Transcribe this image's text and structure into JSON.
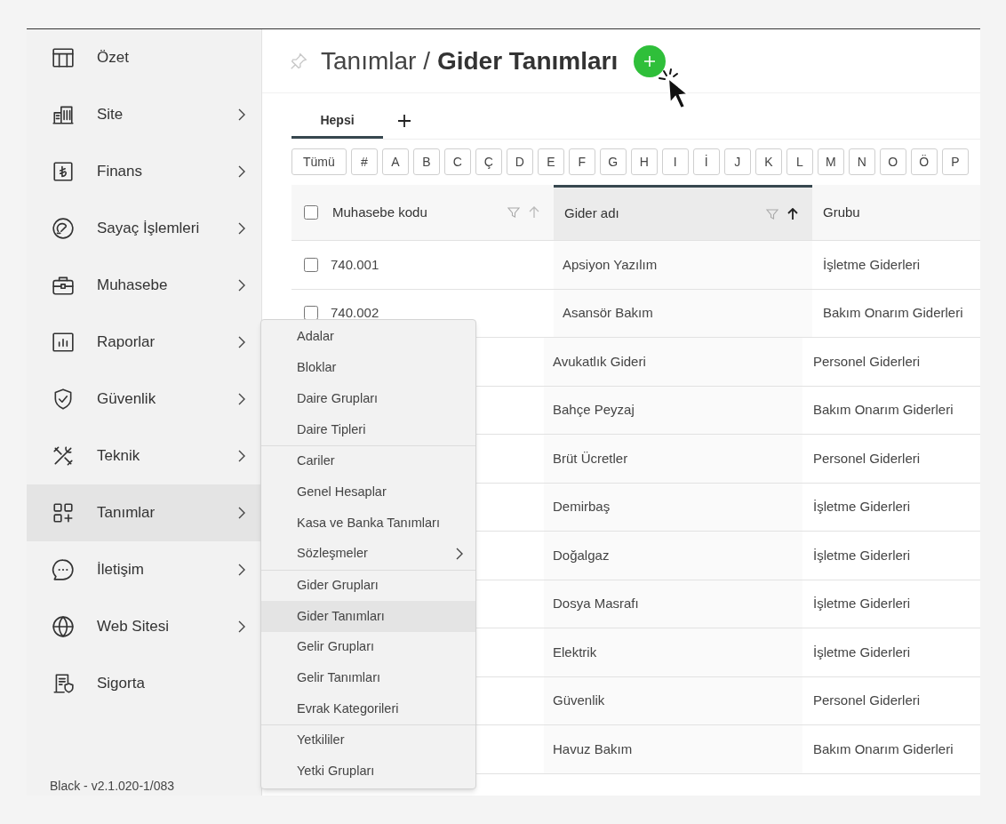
{
  "sidebar": {
    "items": [
      {
        "label": "Özet",
        "has_submenu": false,
        "selected": false
      },
      {
        "label": "Site",
        "has_submenu": true,
        "selected": false
      },
      {
        "label": "Finans",
        "has_submenu": true,
        "selected": false
      },
      {
        "label": "Sayaç İşlemleri",
        "has_submenu": true,
        "selected": false
      },
      {
        "label": "Muhasebe",
        "has_submenu": true,
        "selected": false
      },
      {
        "label": "Raporlar",
        "has_submenu": true,
        "selected": false
      },
      {
        "label": "Güvenlik",
        "has_submenu": true,
        "selected": false
      },
      {
        "label": "Teknik",
        "has_submenu": true,
        "selected": false
      },
      {
        "label": "Tanımlar",
        "has_submenu": true,
        "selected": true
      },
      {
        "label": "İletişim",
        "has_submenu": true,
        "selected": false
      },
      {
        "label": "Web Sitesi",
        "has_submenu": true,
        "selected": false
      },
      {
        "label": "Sigorta",
        "has_submenu": false,
        "selected": false
      }
    ],
    "version": "Black - v2.1.020-1/083"
  },
  "header": {
    "breadcrumb": "Tanımlar /",
    "title": "Gider Tanımları"
  },
  "tabs": [
    {
      "label": "Hepsi",
      "selected": true
    }
  ],
  "letters": [
    "Tümü",
    "#",
    "A",
    "B",
    "C",
    "Ç",
    "D",
    "E",
    "F",
    "G",
    "H",
    "I",
    "İ",
    "J",
    "K",
    "L",
    "M",
    "N",
    "O",
    "Ö",
    "P"
  ],
  "table": {
    "select_all": {
      "checked": false
    },
    "columns": [
      {
        "label": "Muhasebe kodu",
        "sorted": false
      },
      {
        "label": "Gider adı",
        "sorted": true
      },
      {
        "label": "Grubu"
      }
    ],
    "rows": [
      {
        "checked": false,
        "code": "740.001",
        "name": "Apsiyon Yazılım",
        "group": "İşletme Giderleri"
      },
      {
        "checked": false,
        "code": "740.002",
        "name": "Asansör Bakım",
        "group": "Bakım Onarım Giderleri"
      },
      {
        "name": "Avukatlık Gideri",
        "group": "Personel Giderleri"
      },
      {
        "name": "Bahçe Peyzaj",
        "group": "Bakım Onarım Giderleri"
      },
      {
        "name": "Brüt Ücretler",
        "group": "Personel Giderleri"
      },
      {
        "name": "Demirbaş",
        "group": "İşletme Giderleri"
      },
      {
        "name": "Doğalgaz",
        "group": "İşletme Giderleri"
      },
      {
        "name": "Dosya Masrafı",
        "group": "İşletme Giderleri"
      },
      {
        "name": "Elektrik",
        "group": "İşletme Giderleri"
      },
      {
        "name": "Güvenlik",
        "group": "Personel Giderleri"
      },
      {
        "name": "Havuz Bakım",
        "group": "Bakım Onarım Giderleri"
      }
    ]
  },
  "submenu": {
    "groups": [
      [
        {
          "label": "Adalar",
          "selected": false
        },
        {
          "label": "Bloklar",
          "selected": false
        },
        {
          "label": "Daire Grupları",
          "selected": false
        },
        {
          "label": "Daire Tipleri",
          "selected": false
        }
      ],
      [
        {
          "label": "Cariler",
          "selected": false
        },
        {
          "label": "Genel Hesaplar",
          "selected": false
        },
        {
          "label": "Kasa ve Banka Tanımları",
          "selected": false
        },
        {
          "label": "Sözleşmeler",
          "selected": false,
          "has_submenu": true
        }
      ],
      [
        {
          "label": "Gider Grupları",
          "selected": false
        },
        {
          "label": "Gider Tanımları",
          "selected": true
        },
        {
          "label": "Gelir Grupları",
          "selected": false
        },
        {
          "label": "Gelir Tanımları",
          "selected": false
        },
        {
          "label": "Evrak Kategorileri",
          "selected": false
        }
      ],
      [
        {
          "label": "Yetkililer",
          "selected": false
        },
        {
          "label": "Yetki Grupları",
          "selected": false
        }
      ]
    ]
  }
}
